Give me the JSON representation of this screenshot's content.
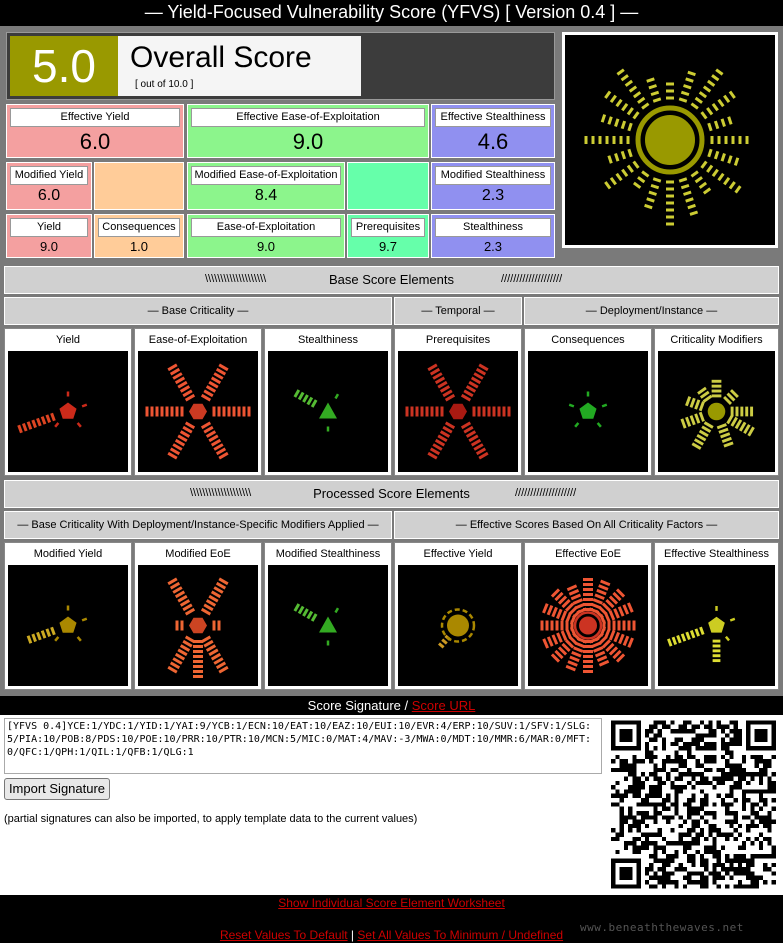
{
  "title": "— Yield-Focused Vulnerability Score (YFVS) [ Version 0.4 ] —",
  "overall": {
    "value": "5.0",
    "label": "Overall Score",
    "sub": "[ out of 10.0 ]",
    "color": "#999900"
  },
  "effective": [
    {
      "label": "Effective Yield",
      "value": "6.0",
      "color": "#f4a0a0"
    },
    {
      "label": "Effective Ease-of-Exploitation",
      "value": "9.0",
      "color": "#8cf58c"
    },
    {
      "label": "Effective Stealthiness",
      "value": "4.6",
      "color": "#9090f0"
    }
  ],
  "modified": [
    {
      "label": "Modified Yield",
      "value": "6.0"
    },
    {
      "label": "Modified Ease-of-Exploitation",
      "value": "8.4"
    },
    {
      "label": "Modified Stealthiness",
      "value": "2.3"
    }
  ],
  "base_values": [
    {
      "label": "Yield",
      "value": "9.0"
    },
    {
      "label": "Consequences",
      "value": "1.0"
    },
    {
      "label": "Ease-of-Exploitation",
      "value": "9.0"
    },
    {
      "label": "Prerequisites",
      "value": "9.7"
    },
    {
      "label": "Stealthiness",
      "value": "2.3"
    }
  ],
  "base_section": {
    "title": "Base Score Elements",
    "left_deco": "\\\\\\\\\\\\\\\\\\\\\\\\\\\\\\\\\\\\\\\\",
    "right_deco": "////////////////////",
    "groups": [
      "— Base Criticality —",
      "— Temporal —",
      "— Deployment/Instance —"
    ],
    "glyphs": [
      "Yield",
      "Ease-of-Exploitation",
      "Stealthiness",
      "Prerequisites",
      "Consequences",
      "Criticality Modifiers"
    ]
  },
  "processed_section": {
    "title": "Processed Score Elements",
    "left_deco": "\\\\\\\\\\\\\\\\\\\\\\\\\\\\\\\\\\\\\\\\",
    "right_deco": "////////////////////",
    "groups": [
      "— Base Criticality With Deployment/Instance-Specific Modifiers Applied —",
      "— Effective Scores Based On All Criticality Factors —"
    ],
    "glyphs": [
      "Modified Yield",
      "Modified EoE",
      "Modified Stealthiness",
      "Effective Yield",
      "Effective EoE",
      "Effective Stealthiness"
    ]
  },
  "signature": {
    "head": "Score Signature /",
    "link": "Score URL",
    "text": "[YFVS 0.4]YCE:1/YDC:1/YID:1/YAI:9/YCB:1/ECN:10/EAT:10/EAZ:10/EUI:10/EVR:4/ERP:10/SUV:1/SFV:1/SLG:5/PIA:10/POB:8/PDS:10/POE:10/PRR:10/PTR:10/MCN:5/MIC:0/MAT:4/MAV:-3/MWA:0/MDT:10/MMR:6/MAR:0/MFT:0/QFC:1/QPH:1/QIL:1/QFB:1/QLG:1",
    "button": "Import Signature",
    "note": "(partial signatures can also be imported, to apply template data to the current values)"
  },
  "footer": {
    "worksheet": "Show Individual Score Element Worksheet",
    "reset": "Reset Values To Default",
    "sep": "|",
    "minimum": "Set All Values To Minimum / Undefined",
    "watermark": "www.beneaththewaves.net"
  }
}
